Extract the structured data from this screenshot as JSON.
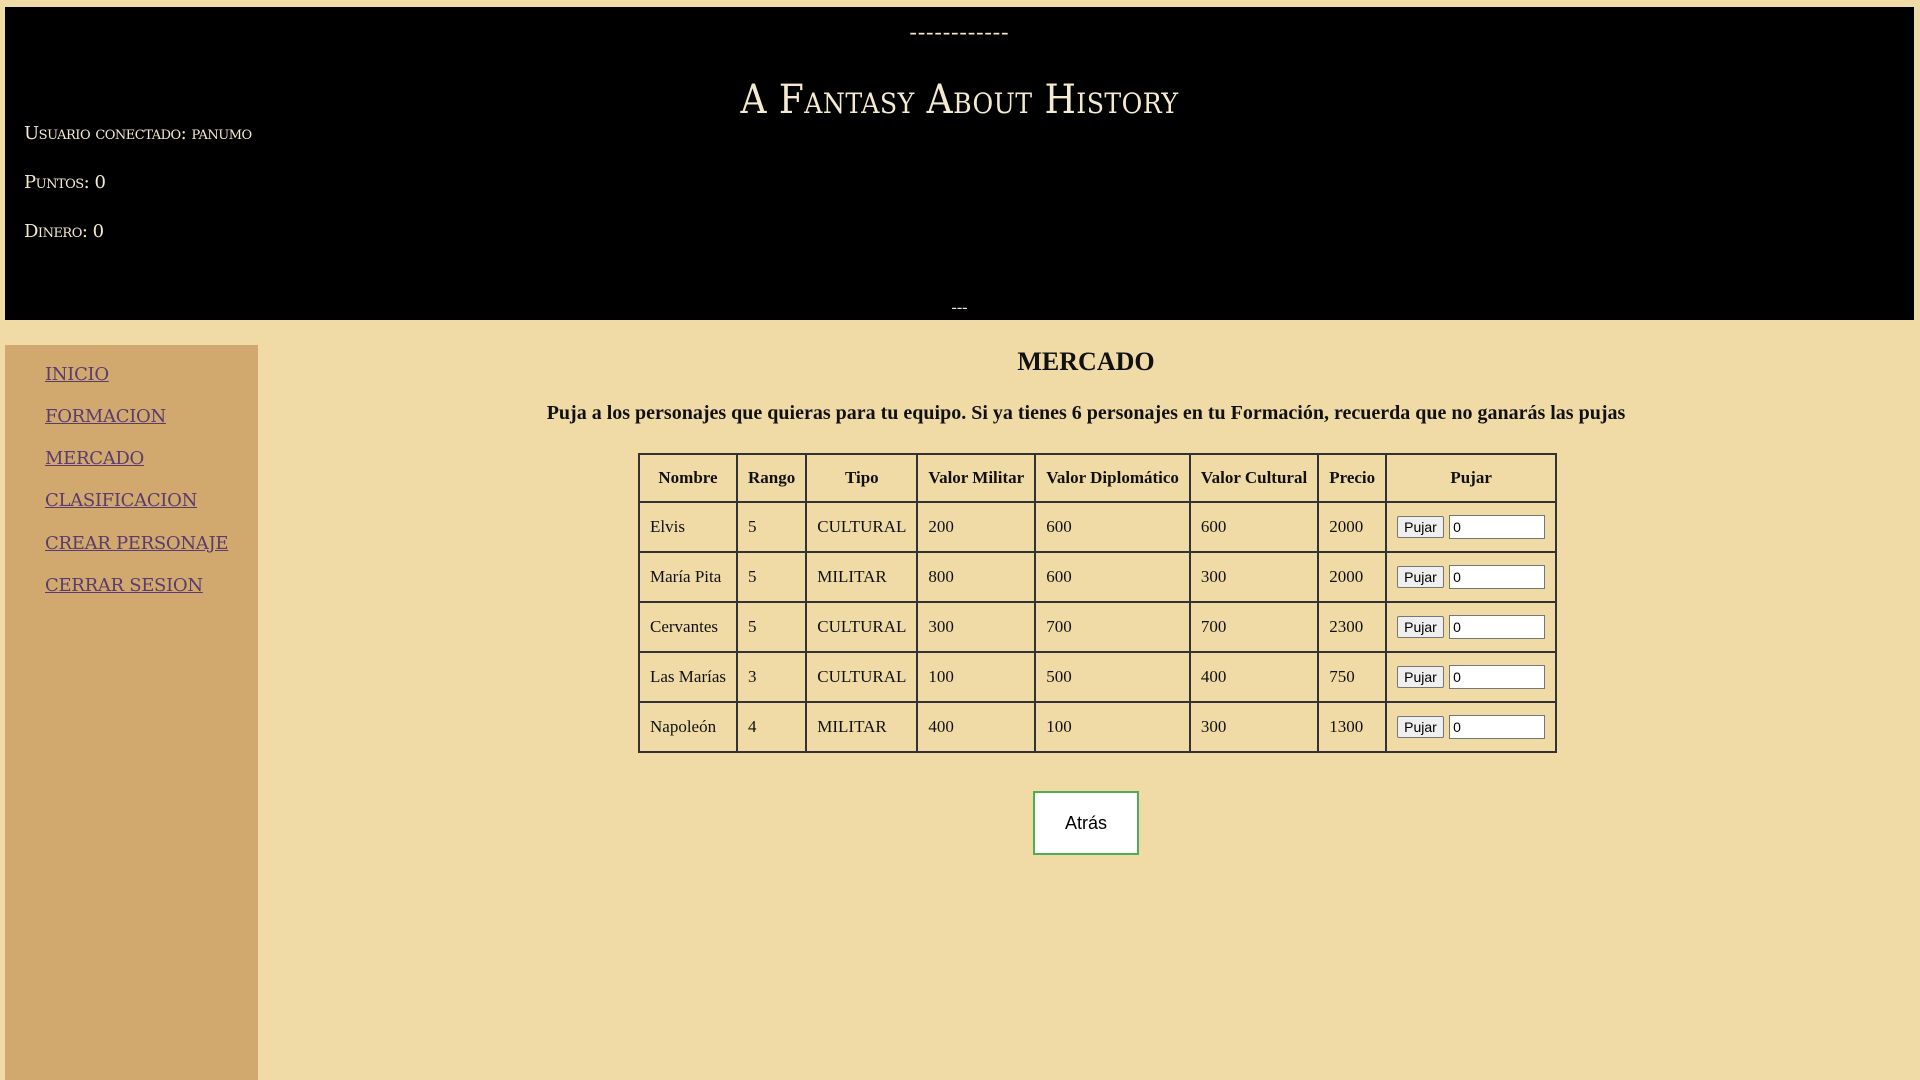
{
  "header": {
    "top_separator": "------------",
    "site_title": "A Fantasy About History",
    "user_label": "Usuario conectado: panumo",
    "points_label": "Puntos: 0",
    "money_label": "Dinero: 0",
    "bottom_separator": "---"
  },
  "sidebar": {
    "items": [
      {
        "label": "INICIO"
      },
      {
        "label": "FORMACION"
      },
      {
        "label": "MERCADO"
      },
      {
        "label": "CLASIFICACION"
      },
      {
        "label": "CREAR PERSONAJE"
      },
      {
        "label": "CERRAR SESION"
      }
    ]
  },
  "main": {
    "title": "MERCADO",
    "instructions": "Puja a los personajes que quieras para tu equipo. Si ya tienes 6 personajes en tu Formación, recuerda que no ganarás las pujas",
    "table": {
      "headers": [
        "Nombre",
        "Rango",
        "Tipo",
        "Valor Militar",
        "Valor Diplomático",
        "Valor Cultural",
        "Precio",
        "Pujar"
      ],
      "rows": [
        {
          "nombre": "Elvis",
          "rango": "5",
          "tipo": "CULTURAL",
          "militar": "200",
          "diplomatico": "600",
          "cultural": "600",
          "precio": "2000",
          "bid_label": "Pujar",
          "bid_value": "0"
        },
        {
          "nombre": "María Pita",
          "rango": "5",
          "tipo": "MILITAR",
          "militar": "800",
          "diplomatico": "600",
          "cultural": "300",
          "precio": "2000",
          "bid_label": "Pujar",
          "bid_value": "0"
        },
        {
          "nombre": "Cervantes",
          "rango": "5",
          "tipo": "CULTURAL",
          "militar": "300",
          "diplomatico": "700",
          "cultural": "700",
          "precio": "2300",
          "bid_label": "Pujar",
          "bid_value": "0"
        },
        {
          "nombre": "Las Marías",
          "rango": "3",
          "tipo": "CULTURAL",
          "militar": "100",
          "diplomatico": "500",
          "cultural": "400",
          "precio": "750",
          "bid_label": "Pujar",
          "bid_value": "0"
        },
        {
          "nombre": "Napoleón",
          "rango": "4",
          "tipo": "MILITAR",
          "militar": "400",
          "diplomatico": "100",
          "cultural": "300",
          "precio": "1300",
          "bid_label": "Pujar",
          "bid_value": "0"
        }
      ]
    },
    "back_label": "Atrás"
  },
  "colors": {
    "page_background": "#f0dba7",
    "header_background": "#000000",
    "sidebar_background": "#d1a86d",
    "link_color": "#5b3a6e",
    "back_button_border": "#4caf50"
  }
}
